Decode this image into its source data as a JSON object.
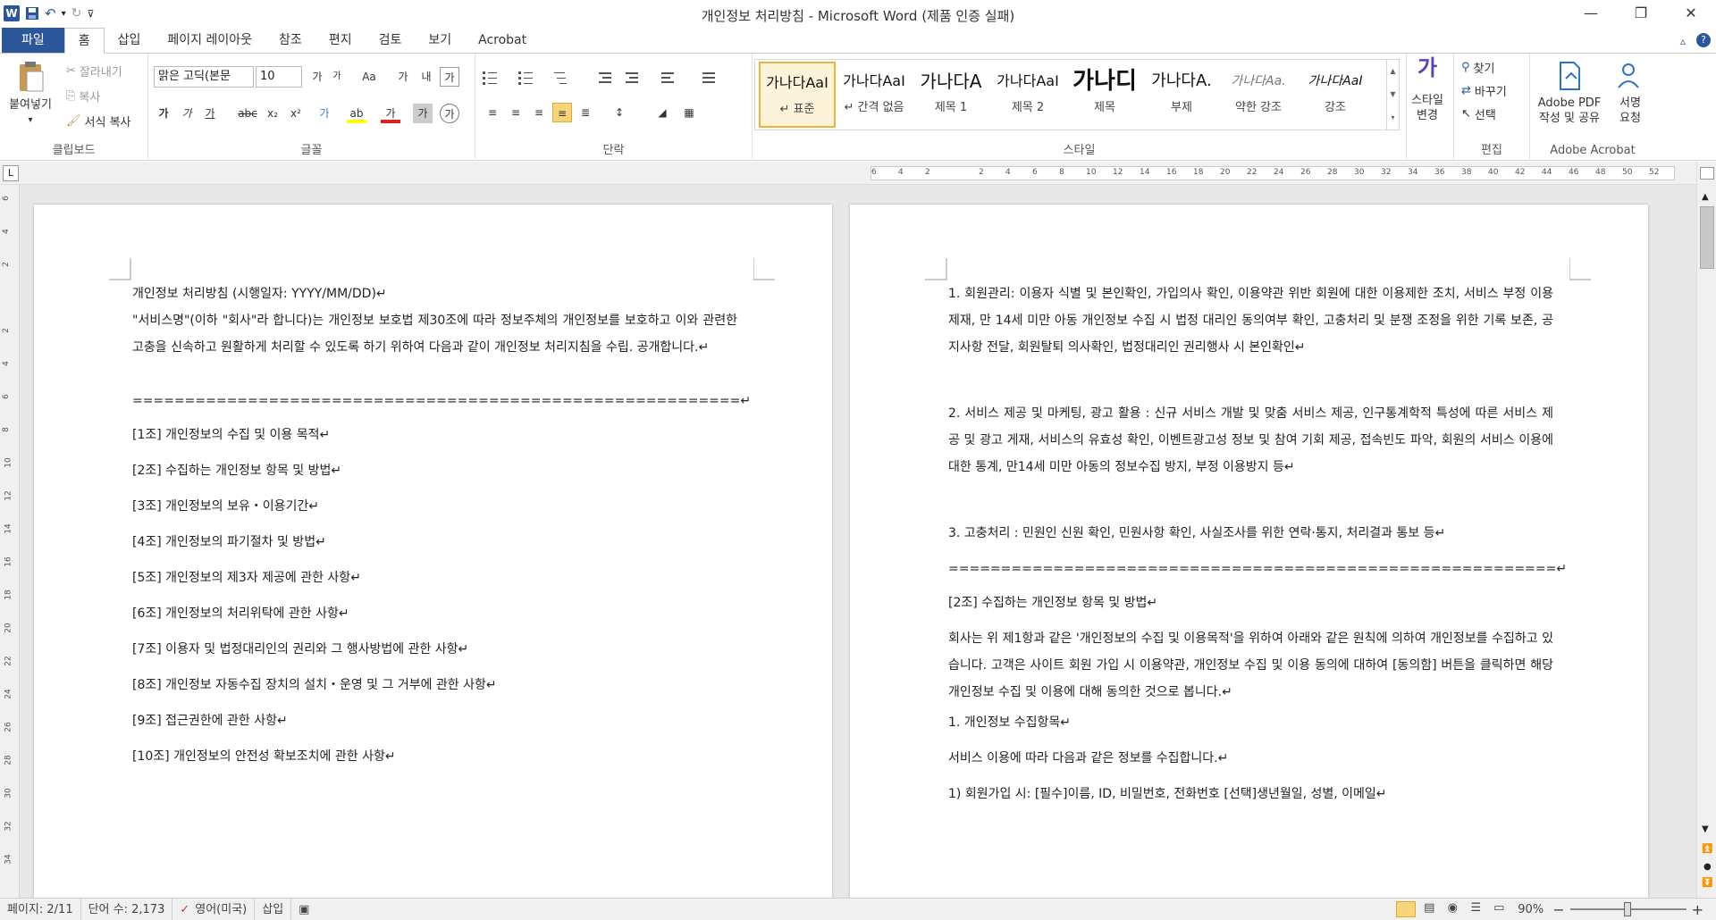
{
  "titlebar": {
    "title": "개인정보 처리방침 - Microsoft Word (제품 인증 실패)",
    "logo": "W",
    "undo_arrow": "↶",
    "dropdown": "▾",
    "redo_arrow": "↻",
    "customize": "⊽"
  },
  "window": {
    "minimize": "—",
    "restore": "❐",
    "close": "✕",
    "ribbon_toggle": "▵",
    "help": "?"
  },
  "tabs": [
    "파일",
    "홈",
    "삽입",
    "페이지 레이아웃",
    "참조",
    "편지",
    "검토",
    "보기",
    "Acrobat"
  ],
  "clipboard": {
    "paste": "붙여넣기",
    "cut": "잘라내기",
    "copy": "복사",
    "format_painter": "서식 복사",
    "label": "클립보드"
  },
  "font": {
    "name": "맑은 고딕(본문",
    "size": "10",
    "label": "글꼴",
    "grow": "가",
    "shrink": "가",
    "case": "Aa",
    "clear": "가",
    "phonetic": "내",
    "border": "가",
    "bold": "가",
    "italic": "가",
    "underline": "가",
    "strike": "abc",
    "sub": "x₂",
    "sup": "x²",
    "effects": "가",
    "highlight": "ab",
    "color": "가",
    "shade": "가",
    "circle": "가"
  },
  "paragraph": {
    "label": "단락"
  },
  "styles": {
    "label": "스타일",
    "items": [
      {
        "preview": "가나다AaI",
        "name": "↵ 표준"
      },
      {
        "preview": "가나다AaI",
        "name": "↵ 간격 없음"
      },
      {
        "preview": "가나다A",
        "name": "제목 1"
      },
      {
        "preview": "가나다AaI",
        "name": "제목 2"
      },
      {
        "preview": "가나디",
        "name": "제목"
      },
      {
        "preview": "가나다A.",
        "name": "부제"
      },
      {
        "preview": "가나다Aa.",
        "name": "약한 강조"
      },
      {
        "preview": "가나다AaI",
        "name": "강조"
      }
    ],
    "change_line1": "스타일",
    "change_line2": "변경"
  },
  "editing": {
    "find": "찾기",
    "replace": "바꾸기",
    "select": "선택",
    "label": "편집"
  },
  "acrobat": {
    "pdf_line1": "Adobe PDF",
    "pdf_line2": "작성 및 공유",
    "sign_line1": "서명",
    "sign_line2": "요청",
    "label": "Adobe Acrobat"
  },
  "ruler": {
    "tab_marker": "L",
    "hticks": [
      "6",
      "4",
      "2",
      "",
      "2",
      "4",
      "6",
      "8",
      "10",
      "12",
      "14",
      "16",
      "18",
      "20",
      "22",
      "24",
      "26",
      "28",
      "30",
      "32",
      "34",
      "36",
      "38",
      "40",
      "42",
      "44",
      "46",
      "48",
      "50",
      "52"
    ],
    "vticks": [
      "6",
      "4",
      "2",
      "",
      "2",
      "4",
      "6",
      "8",
      "10",
      "12",
      "14",
      "16",
      "18",
      "20",
      "22",
      "24",
      "26",
      "28",
      "30",
      "32",
      "34"
    ]
  },
  "page1": [
    "개인정보 처리방침 (시행일자: YYYY/MM/DD)↵",
    "\"서비스명\"(이하 \"회사\"라 합니다)는 개인정보 보호법 제30조에 따라 정보주체의 개인정보를 보호하고 이와 관련한 고충을 신속하고 원활하게 처리할 수 있도록 하기 위하여 다음과 같이 개인정보 처리지침을 수립. 공개합니다.↵",
    "==========================================================↵",
    "[1조] 개인정보의 수집 및 이용 목적↵",
    "[2조] 수집하는 개인정보 항목 및 방법↵",
    "[3조] 개인정보의 보유・이용기간↵",
    "[4조] 개인정보의 파기절차 및 방법↵",
    "[5조] 개인정보의 제3자 제공에 관한 사항↵",
    "[6조] 개인정보의 처리위탁에 관한 사항↵",
    "[7조] 이용자 및 법정대리인의 권리와 그 행사방법에 관한 사항↵",
    "[8조] 개인정보 자동수집 장치의 설치・운영 및 그 거부에 관한 사항↵",
    "[9조] 접근권한에 관한 사항↵",
    "[10조] 개인정보의 안전성 확보조치에 관한 사항↵"
  ],
  "page2": [
    "1. 회원관리: 이용자 식별 및 본인확인, 가입의사 확인, 이용약관 위반 회원에 대한 이용제한 조치, 서비스 부정 이용 제재, 만 14세 미만 아동 개인정보 수집 시 법정 대리인 동의여부 확인, 고충처리 및 분쟁 조정을 위한 기록 보존, 공지사항 전달, 회원탈퇴 의사확인, 법정대리인 권리행사 시 본인확인↵",
    "2. 서비스 제공 및 마케팅, 광고 활용 : 신규 서비스 개발 및 맞춤 서비스 제공, 인구통계학적 특성에 따른 서비스 제공 및 광고 게재, 서비스의 유효성 확인, 이벤트광고성 정보 및 참여 기회 제공, 접속빈도 파악, 회원의 서비스 이용에 대한 통계, 만14세 미만 아동의 정보수집 방지, 부정 이용방지 등↵",
    "3. 고충처리 : 민원인 신원 확인, 민원사항 확인, 사실조사를 위한 연락·통지, 처리결과 통보 등↵",
    "==========================================================↵",
    "[2조] 수집하는 개인정보 항목 및 방법↵",
    "회사는 위 제1항과 같은 '개인정보의 수집 및 이용목적'을 위하여 아래와 같은 원칙에 의하여 개인정보를 수집하고 있습니다. 고객은 사이트 회원 가입 시 이용약관, 개인정보 수집 및 이용 동의에 대하여 [동의함] 버튼을 클릭하면 해당 개인정보 수집 및 이용에 대해 동의한 것으로 봅니다.↵",
    "1. 개인정보 수집항목↵",
    "서비스 이용에 따라 다음과 같은 정보를 수집합니다.↵",
    "1) 회원가입 시: [필수]이름, ID, 비밀번호, 전화번호 [선택]생년월일, 성별, 이메일↵"
  ],
  "status": {
    "page": "페이지: 2/11",
    "words": "단어 수: 2,173",
    "language": "영어(미국)",
    "mode": "삽입",
    "zoom": "90%",
    "minus": "−",
    "plus": "+"
  },
  "colors": {
    "accent": "#2b579a",
    "highlight": "#f7d67a",
    "font_red": "#e02020",
    "yellow": "#ffff00"
  }
}
